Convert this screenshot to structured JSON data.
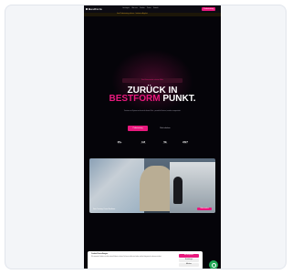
{
  "nav": {
    "logo": "Bestform",
    "links": [
      "Leistungen",
      "Über uns",
      "Studios",
      "Preise",
      "Kontakt"
    ],
    "cta": "Probetraining"
  },
  "banner": {
    "text": "Jetzt Probetraining sichern – limitiertes Angebot"
  },
  "hero": {
    "eyebrow": "Dein Fitnessstudio in deiner Nähe",
    "headline_line1": "ZURÜCK IN",
    "headline_pink": "BESTFORM",
    "headline_rest": " PUNKT.",
    "subtitle": "Trainiere mit System und erreiche deine Ziele – persönlich betreut, modern ausgestattet.",
    "primary_cta": "Probetraining",
    "secondary_cta": "Mehr erfahren"
  },
  "stats": [
    {
      "value": "15+",
      "label": "Studios"
    },
    {
      "value": "4.8",
      "label": "Bewertung"
    },
    {
      "value": "5k",
      "label": "Mitglieder"
    },
    {
      "value": "24/7",
      "label": "Geöffnet"
    }
  ],
  "video": {
    "caption": "Dein Training. Deine Bestform.",
    "button": "Video ansehen"
  },
  "cookie": {
    "title": "Cookie Einstellungen",
    "text": "Wir verwenden Cookies, um dir das beste Erlebnis zu bieten. Du kannst selbst entscheiden, welche Kategorien du zulassen möchtest.",
    "accept": "Alle akzeptieren",
    "settings": "Einstellungen",
    "decline": "Ablehnen"
  },
  "colors": {
    "accent": "#e8197d",
    "background": "#050409",
    "chat": "#1fa855"
  }
}
